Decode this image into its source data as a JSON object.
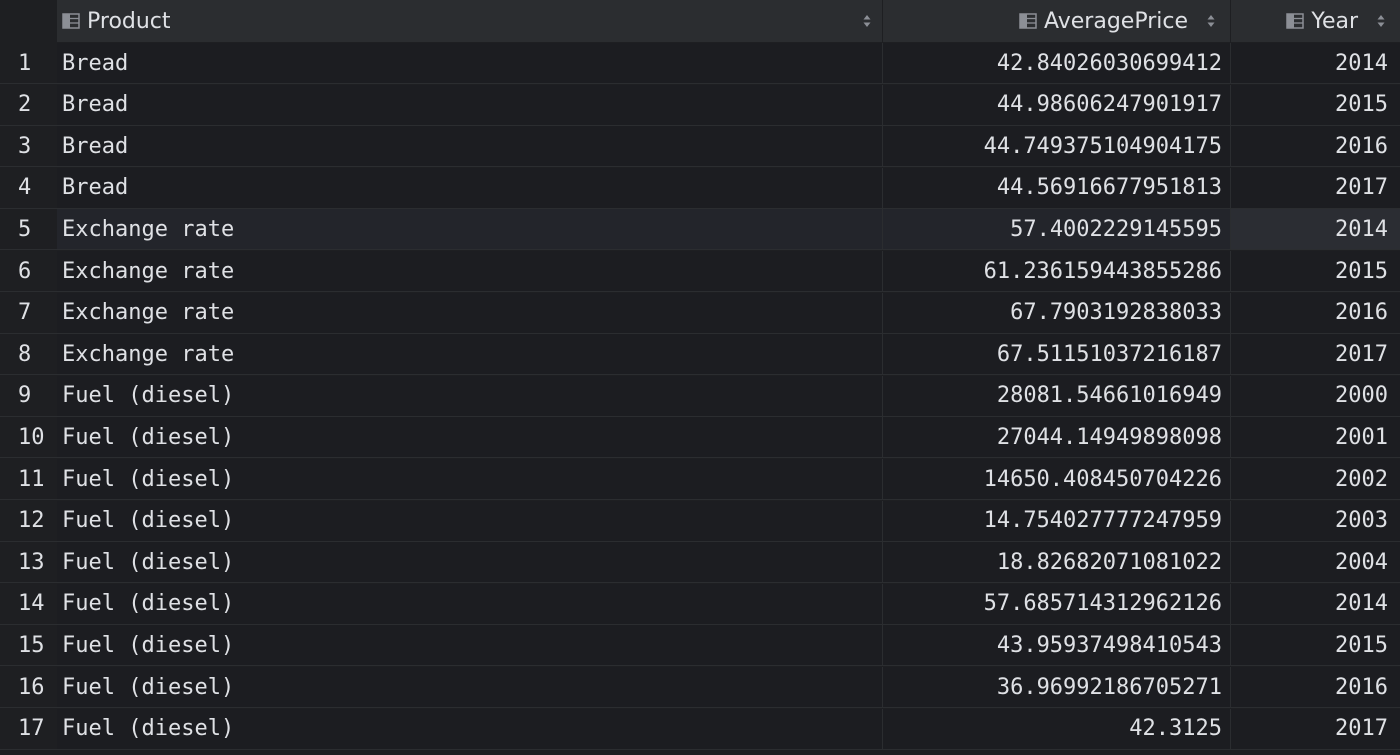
{
  "columns": {
    "product": "Product",
    "average_price": "AveragePrice",
    "year": "Year"
  },
  "icons": {
    "column_icon": "table-column-icon",
    "sort_icon": "sort-arrows-icon"
  },
  "colors": {
    "background": "#1e1f22",
    "header_background": "#2b2d30",
    "text": "#dfe1e5",
    "selected_row": "#23252b"
  },
  "selected_row_index": 5,
  "rows": [
    {
      "num": "1",
      "product": "Bread",
      "price": "42.84026030699412",
      "year": "2014"
    },
    {
      "num": "2",
      "product": "Bread",
      "price": "44.98606247901917",
      "year": "2015"
    },
    {
      "num": "3",
      "product": "Bread",
      "price": "44.749375104904175",
      "year": "2016"
    },
    {
      "num": "4",
      "product": "Bread",
      "price": "44.56916677951813",
      "year": "2017"
    },
    {
      "num": "5",
      "product": "Exchange rate",
      "price": "57.4002229145595",
      "year": "2014"
    },
    {
      "num": "6",
      "product": "Exchange rate",
      "price": "61.236159443855286",
      "year": "2015"
    },
    {
      "num": "7",
      "product": "Exchange rate",
      "price": "67.7903192838033",
      "year": "2016"
    },
    {
      "num": "8",
      "product": "Exchange rate",
      "price": "67.51151037216187",
      "year": "2017"
    },
    {
      "num": "9",
      "product": "Fuel (diesel)",
      "price": "28081.54661016949",
      "year": "2000"
    },
    {
      "num": "10",
      "product": "Fuel (diesel)",
      "price": "27044.14949898098",
      "year": "2001"
    },
    {
      "num": "11",
      "product": "Fuel (diesel)",
      "price": "14650.408450704226",
      "year": "2002"
    },
    {
      "num": "12",
      "product": "Fuel (diesel)",
      "price": "14.754027777247959",
      "year": "2003"
    },
    {
      "num": "13",
      "product": "Fuel (diesel)",
      "price": "18.82682071081022",
      "year": "2004"
    },
    {
      "num": "14",
      "product": "Fuel (diesel)",
      "price": "57.685714312962126",
      "year": "2014"
    },
    {
      "num": "15",
      "product": "Fuel (diesel)",
      "price": "43.95937498410543",
      "year": "2015"
    },
    {
      "num": "16",
      "product": "Fuel (diesel)",
      "price": "36.96992186705271",
      "year": "2016"
    },
    {
      "num": "17",
      "product": "Fuel (diesel)",
      "price": "42.3125",
      "year": "2017"
    }
  ]
}
